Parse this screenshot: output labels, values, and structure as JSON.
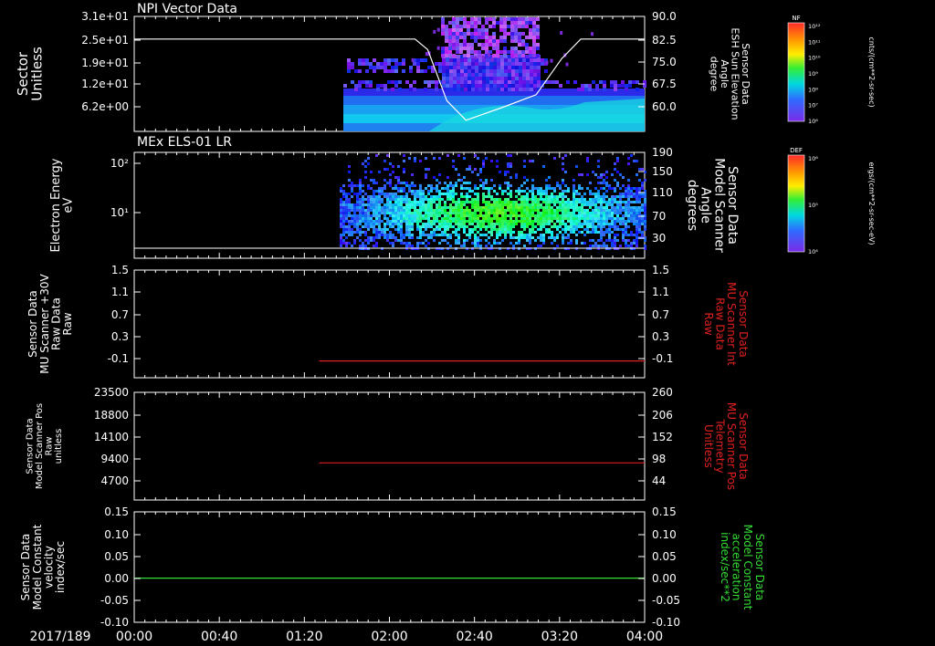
{
  "date_label": "2017/189",
  "time_ticks": [
    "00:00",
    "00:40",
    "01:20",
    "02:00",
    "02:40",
    "03:20",
    "04:00"
  ],
  "colors": {
    "white": "#ffffff",
    "red": "#e02020",
    "green": "#33dd33",
    "background": "#000000"
  },
  "chart_data": [
    {
      "id": "npi",
      "type": "heatmap",
      "title": "NPI Vector Data",
      "left_label": [
        "Sector",
        "Unitless"
      ],
      "left_ticks": [
        "3.1e+01",
        "2.5e+01",
        "1.9e+01",
        "1.2e+01",
        "6.2e+00"
      ],
      "right_label": [
        "Sensor Data",
        "ESH Sun Elevation",
        "Angle",
        "degree"
      ],
      "right_ticks": [
        "90.0",
        "82.5",
        "75.0",
        "67.5",
        "60.0"
      ],
      "overlay_line": {
        "x_hours": [
          0.0,
          2.2,
          2.3,
          2.45,
          2.6,
          2.9,
          3.15,
          3.35,
          3.5,
          4.0
        ],
        "y_deg": [
          82.5,
          82.5,
          79.0,
          62.0,
          55.5,
          60.0,
          64.0,
          76.0,
          82.5,
          82.5
        ]
      },
      "colorbar": {
        "label": "NF",
        "unit": "cnts/(cm**2-sr-sec)",
        "ticks": [
          "10¹²",
          "10¹¹",
          "10¹⁰",
          "10⁹",
          "10⁸",
          "10⁷",
          "10⁶"
        ]
      }
    },
    {
      "id": "els",
      "type": "heatmap",
      "title": "MEx ELS-01 LR",
      "left_label": [
        "Electron Energy",
        "eV"
      ],
      "left_ticks": [
        "10²",
        "10¹"
      ],
      "right_label": [
        "Sensor Data",
        "Model Scanner",
        "Angle",
        "degrees"
      ],
      "right_ticks": [
        "190",
        "150",
        "110",
        "70",
        "30"
      ],
      "colorbar": {
        "label": "DEF",
        "unit": "ergs/(cm**2-sr-sec-eV)",
        "ticks": [
          "10⁶",
          "10⁵",
          "10⁴"
        ]
      }
    },
    {
      "id": "p3",
      "type": "line",
      "left_label": [
        "Sensor Data",
        "MU Scanner +30V",
        "Raw Data",
        "Raw"
      ],
      "left_ticks": [
        "1.5",
        "1.1",
        "0.7",
        "0.3",
        "-0.1"
      ],
      "right_label": [
        "Sensor Data",
        "MU Scanner Int",
        "Raw Data",
        "Raw"
      ],
      "right_ticks": [
        "1.5",
        "1.1",
        "0.7",
        "0.3",
        "-0.1"
      ],
      "ylim": [
        -0.3,
        1.5
      ],
      "series": [
        {
          "color": "#e02020",
          "x": [
            1.45,
            4.0
          ],
          "y": [
            -0.02,
            -0.02
          ]
        }
      ]
    },
    {
      "id": "p4",
      "type": "line",
      "left_label": [
        "Sensor Data",
        "Model Scanner Pos",
        "Raw",
        "unitless"
      ],
      "left_ticks": [
        "23500",
        "18800",
        "14100",
        "9400",
        "4700"
      ],
      "right_label": [
        "Sensor Data",
        "MU Scanner Pos",
        "Telemetry",
        "Unitless"
      ],
      "right_ticks": [
        "260",
        "206",
        "152",
        "98",
        "44"
      ],
      "ylim": [
        0,
        23500
      ],
      "series": [
        {
          "color": "#e02020",
          "x": [
            1.45,
            4.0
          ],
          "y": [
            8100,
            8100
          ]
        }
      ]
    },
    {
      "id": "p5",
      "type": "line",
      "left_label": [
        "Sensor Data",
        "Model Constant",
        "velocity",
        "index/sec"
      ],
      "left_ticks": [
        "0.15",
        "0.10",
        "0.05",
        "0.00",
        "-0.05",
        "-0.10"
      ],
      "right_label": [
        "Sensor Data",
        "Model Constant",
        "acceleration",
        "index/sec**2"
      ],
      "right_ticks": [
        "0.15",
        "0.10",
        "0.05",
        "0.00",
        "-0.05",
        "-0.10"
      ],
      "ylim": [
        -0.1,
        0.15
      ],
      "series": [
        {
          "color": "#33dd33",
          "x": [
            0.0,
            4.0
          ],
          "y": [
            0.0,
            0.0
          ]
        }
      ]
    }
  ]
}
